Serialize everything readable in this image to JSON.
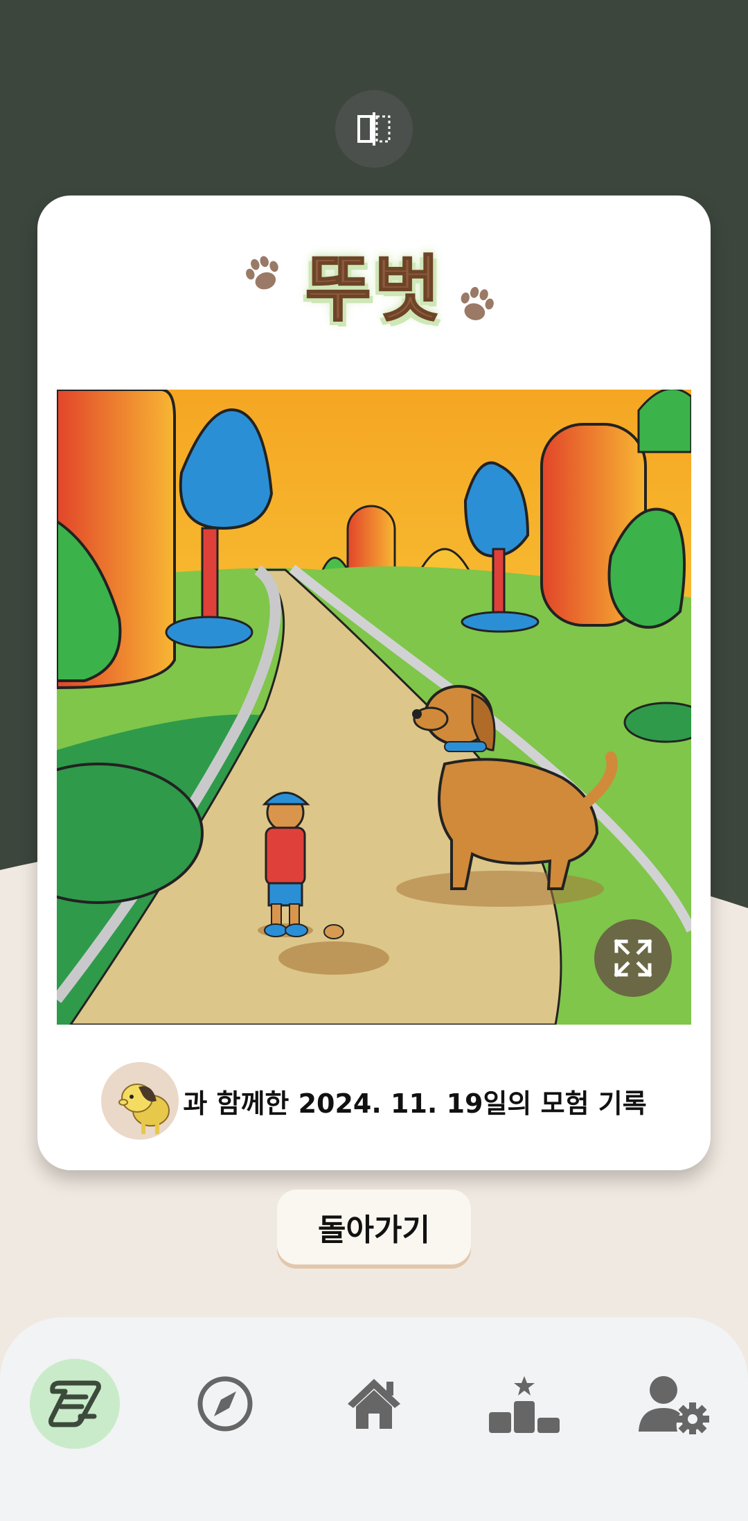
{
  "story": {
    "title": "뚜벗",
    "caption": "과 함께한 2024. 11. 19일의 모험 기록"
  },
  "actions": {
    "back_label": "돌아가기"
  },
  "colors": {
    "header_bg": "#3c463d",
    "page_bg": "#f0e9e1",
    "title_brown": "#8c5a3c",
    "title_glow": "#cfe7b7",
    "nav_active_bg": "#c9ebc9",
    "nav_icon": "#666666"
  },
  "icons": {
    "compare": "compare-icon",
    "paw": "paw-icon",
    "expand": "expand-icon",
    "nav": [
      "scroll-icon",
      "compass-icon",
      "home-icon",
      "leaderboard-icon",
      "user-settings-icon"
    ]
  }
}
